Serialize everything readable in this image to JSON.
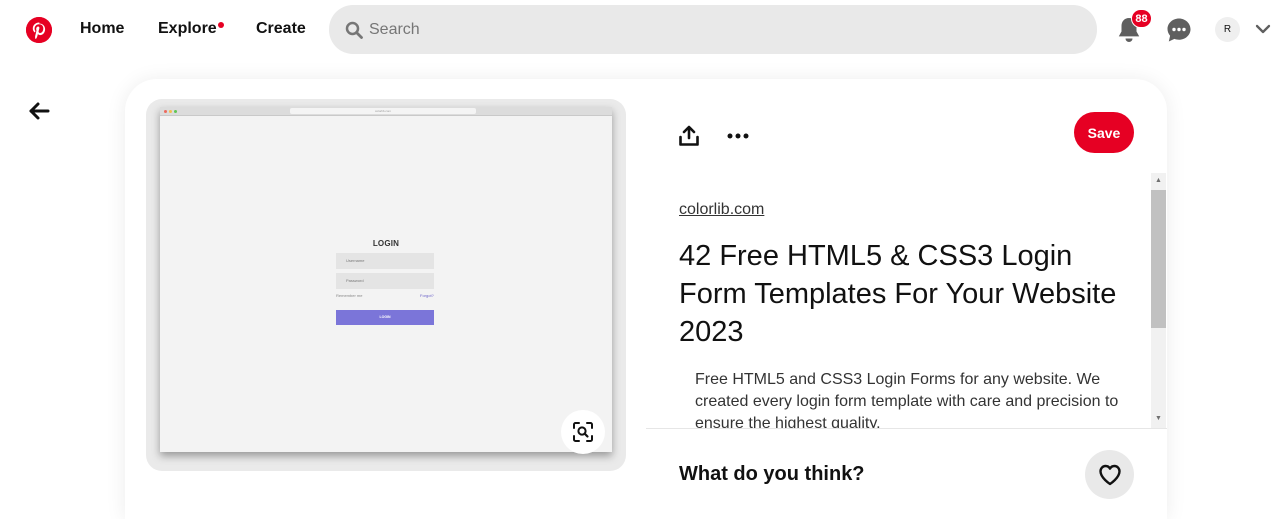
{
  "header": {
    "nav": {
      "home": "Home",
      "explore": "Explore",
      "create": "Create"
    },
    "search": {
      "placeholder": "Search",
      "value": ""
    },
    "notifications_count": "88",
    "avatar_initial": "R"
  },
  "pin": {
    "image": {
      "login_title": "LOGIN",
      "username_placeholder": "Username",
      "password_placeholder": "Password",
      "remember_label": "Remember me",
      "forgot_label": "Forgot?",
      "login_button": "LOGIN",
      "url_text": "colorlib.com"
    },
    "save_label": "Save",
    "source": "colorlib.com",
    "title": "42 Free HTML5 & CSS3 Login Form Templates For Your Website 2023",
    "description": "Free HTML5 and CSS3 Login Forms for any website. We created every login form template with care and precision to ensure the highest quality.",
    "comment_prompt": "What do you think?"
  },
  "colors": {
    "brand": "#e60023",
    "search_bg": "#e9e9e9",
    "login_accent": "#7b75d9"
  },
  "icons": [
    "pinterest-logo-icon",
    "search-icon",
    "bell-icon",
    "chat-icon",
    "chevron-down-icon",
    "back-arrow-icon",
    "share-icon",
    "more-icon",
    "visual-search-icon",
    "heart-icon"
  ]
}
